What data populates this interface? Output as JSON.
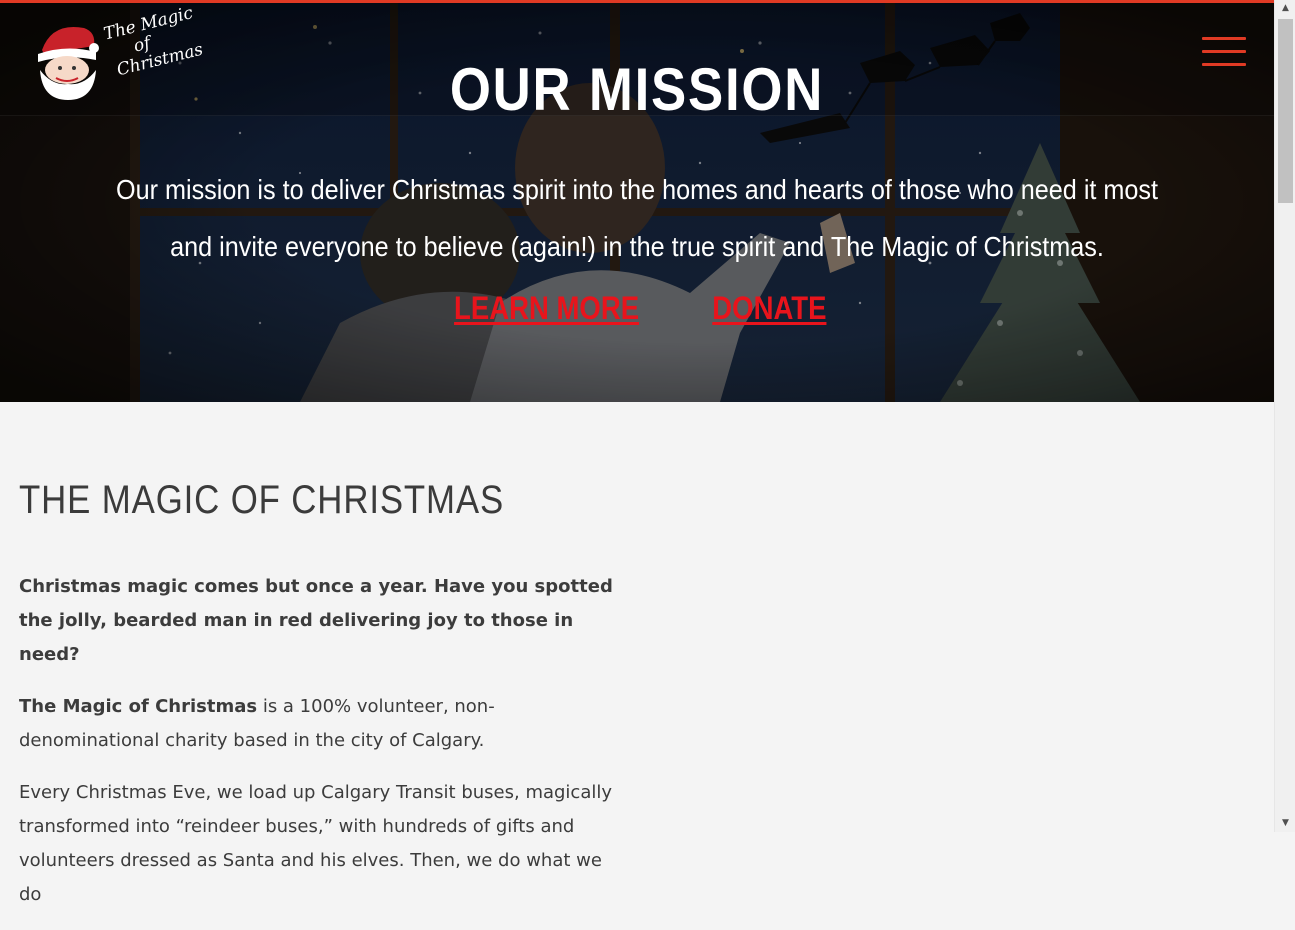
{
  "header": {
    "logo_lines": [
      "The Magic",
      "of",
      "Christmas"
    ],
    "menu_icon": "hamburger-menu-icon"
  },
  "hero": {
    "title": "OUR MISSION",
    "text": "Our mission is to deliver Christmas spirit into the homes and hearts of those who need it most and invite everyone to believe (again!) in the true spirit and The Magic of Christmas.",
    "learn_more": "LEARN MORE",
    "donate": "DONATE"
  },
  "content": {
    "heading": "THE MAGIC OF CHRISTMAS",
    "lead": "Christmas magic comes but once a year. Have you spotted the jolly, bearded man in red delivering joy to those in need?",
    "p2_bold": "The Magic of Christmas",
    "p2_rest": " is a 100% volunteer, non-denominational charity based in the city of Calgary.",
    "p3": "Every Christmas Eve, we load up Calgary Transit buses, magically transformed into “reindeer buses,” with hundreds of gifts and volunteers dressed as Santa and his elves. Then, we do what we do"
  },
  "scrollbar": {
    "up_icon": "scroll-up-arrow-icon",
    "down_icon": "scroll-down-arrow-icon"
  },
  "colors": {
    "accent": "#e03a24",
    "link_red": "#e8141c",
    "page_bg": "#f4f4f4",
    "text": "#3c3c3c"
  }
}
